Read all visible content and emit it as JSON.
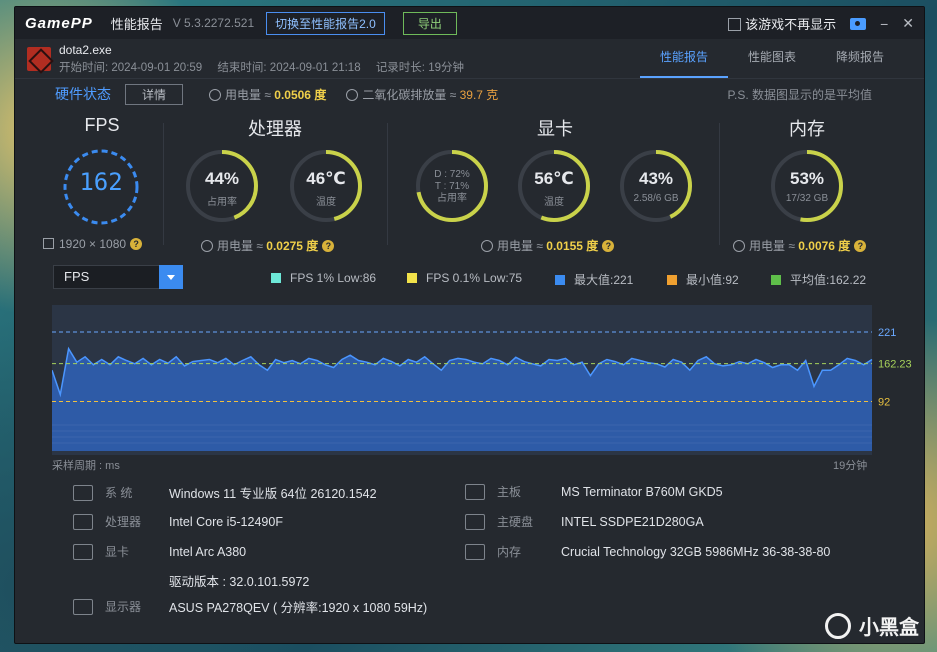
{
  "app": {
    "logo": "GamePP",
    "title": "性能报告",
    "version": "V 5.3.2272.521",
    "switch_label": "切换至性能报告2.0",
    "export_label": "导出",
    "hide_in_game_label": "该游戏不再显示",
    "minimize": "−",
    "close": "✕"
  },
  "game": {
    "name": "dota2.exe",
    "start": "开始时间: 2024-09-01 20:59",
    "end": "结束时间: 2024-09-01 21:18",
    "duration": "记录时长: 19分钟"
  },
  "tabs": [
    "性能报告",
    "性能图表",
    "降频报告"
  ],
  "hardware": {
    "title": "硬件状态",
    "detail_label": "详情",
    "power_label": "用电量 ≈",
    "power_value": "0.0506 度",
    "co2_label": "二氧化碳排放量 ≈",
    "co2_value": "39.7 克",
    "note": "P.S. 数据图显示的是平均值"
  },
  "metrics": {
    "fps": {
      "title": "FPS",
      "value": "162",
      "resolution": "1920 × 1080"
    },
    "cpu": {
      "title": "处理器",
      "usage": "44%",
      "usage_label": "占用率",
      "usage_pct": 44,
      "temp": "46℃",
      "temp_label": "温度",
      "temp_pct": 46,
      "power_label": "用电量 ≈",
      "power_value": "0.0275 度"
    },
    "gpu": {
      "title": "显卡",
      "d": "D : 72%",
      "t": "T : 71%",
      "usage_label": "占用率",
      "usage_pct": 72,
      "temp": "56℃",
      "temp_label": "温度",
      "temp_pct": 56,
      "vram": "43%",
      "vram_sub": "2.58/6 GB",
      "vram_pct": 43,
      "power_label": "用电量 ≈",
      "power_value": "0.0155 度"
    },
    "mem": {
      "title": "内存",
      "usage": "53%",
      "usage_sub": "17/32 GB",
      "usage_pct": 53,
      "power_label": "用电量 ≈",
      "power_value": "0.0076 度"
    }
  },
  "chart_controls": {
    "selected": "FPS",
    "legend": [
      {
        "label": "FPS 1% Low:86",
        "color": "#6de8d8"
      },
      {
        "label": "FPS 0.1% Low:75",
        "color": "#f2e24a"
      },
      {
        "label": "最大值:221",
        "color": "#3b8bf0"
      },
      {
        "label": "最小值:92",
        "color": "#f0a030"
      },
      {
        "label": "平均值:162.22",
        "color": "#5fbf4a"
      }
    ],
    "x_left_note": "采样周期 : ms",
    "x_right_note": "19分钟"
  },
  "chart_data": {
    "type": "area",
    "title": "",
    "ylabel": "",
    "ylim": [
      0,
      260
    ],
    "ref_lines": [
      {
        "label": "221",
        "value": 221
      },
      {
        "label": "162.23",
        "value": 162.23
      },
      {
        "label": "92",
        "value": 92
      }
    ],
    "series": [
      {
        "values": [
          150,
          105,
          190,
          165,
          175,
          160,
          170,
          160,
          175,
          168,
          162,
          172,
          160,
          170,
          163,
          175,
          158,
          166,
          168,
          170,
          164,
          172,
          160,
          168,
          175,
          160,
          150,
          170,
          164,
          168,
          162,
          172,
          168,
          160,
          155,
          170,
          178,
          168,
          165,
          160,
          172,
          166,
          158,
          170,
          165,
          175,
          162,
          150,
          168,
          172,
          170,
          165,
          162,
          172,
          168,
          160,
          174,
          166,
          162,
          158,
          170,
          168,
          172,
          160,
          165,
          140,
          162,
          170,
          166,
          160,
          172,
          168,
          164,
          162,
          156,
          170,
          165,
          150,
          168,
          175,
          162,
          158,
          160,
          166,
          162,
          170,
          164,
          155,
          160,
          160,
          150,
          168,
          120,
          150,
          150,
          160,
          172,
          168,
          160,
          170
        ]
      }
    ]
  },
  "system": {
    "os_label": "系  统",
    "os": "Windows 11 专业版 64位 26120.1542",
    "cpu_label": "处理器",
    "cpu": "Intel Core i5-12490F",
    "gpu_label": "显卡",
    "gpu": "Intel Arc A380",
    "driver": "驱动版本 : 32.0.101.5972",
    "monitor_label": "显示器",
    "monitor": "ASUS PA278QEV ( 分辨率:1920 x 1080 59Hz)",
    "board_label": "主板",
    "board": "MS Terminator B760M GKD5",
    "disk_label": "主硬盘",
    "disk": "INTEL SSDPE21D280GA",
    "ram_label": "内存",
    "ram": "Crucial Technology 32GB 5986MHz 36-38-38-80"
  },
  "watermark": "小黑盒",
  "colors": {
    "accent": "#4f9cff",
    "gauge_arc": "#c9d24a",
    "gauge_track": "#3a3f47"
  }
}
